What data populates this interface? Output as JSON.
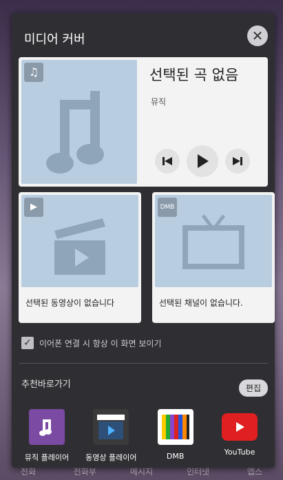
{
  "panel": {
    "title": "미디어 커버",
    "close_icon": "close-icon"
  },
  "music": {
    "title": "선택된 곡 없음",
    "subtitle": "뮤직",
    "corner_icon": "music-note-icon"
  },
  "video_tile": {
    "label": "선택된 동영상이 없습니다",
    "corner_icon": "play-icon"
  },
  "dmb_tile": {
    "label": "선택된 채널이 없습니다.",
    "corner_icon": "dmb-icon"
  },
  "option": {
    "label": "이어폰 연결 시 항상 이 화면 보이기",
    "checked": true
  },
  "recommended": {
    "title": "추천바로가기",
    "edit_label": "편집",
    "items": [
      {
        "label": "뮤직 플레이어",
        "icon": "music-app-icon",
        "color": "#7b4aa3"
      },
      {
        "label": "동영상 플레이어",
        "icon": "video-app-icon",
        "color": "#3a3a3a"
      },
      {
        "label": "DMB",
        "icon": "dmb-app-icon",
        "color": "#ffffff"
      },
      {
        "label": "YouTube",
        "icon": "youtube-icon",
        "color": "#e02020"
      }
    ]
  },
  "dock": {
    "items": [
      {
        "label": "전화"
      },
      {
        "label": "전화부"
      },
      {
        "label": "메시지"
      },
      {
        "label": "인터넷"
      },
      {
        "label": "앱스"
      }
    ]
  }
}
